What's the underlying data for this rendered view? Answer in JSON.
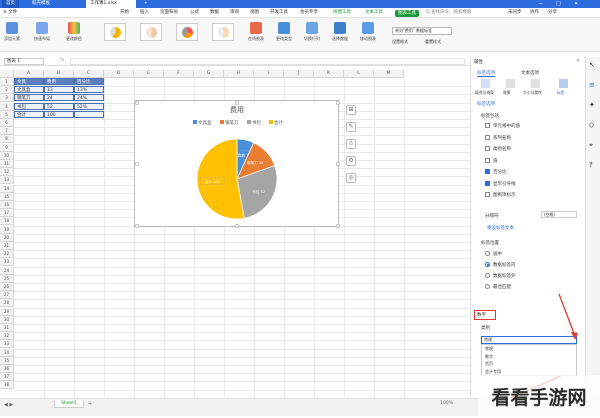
{
  "titlebar": {
    "tabs": [
      {
        "label": "首页"
      },
      {
        "label": "稻壳模板"
      },
      {
        "label": "工作簿1.xlsx"
      },
      {
        "label": "+"
      }
    ],
    "right": {
      "cloud": "未登录",
      "share": "分享"
    }
  },
  "menubar": {
    "file": "≡ 文件",
    "items": [
      "开始",
      "插入",
      "页面布局",
      "公式",
      "数据",
      "审阅",
      "视图",
      "开发工具",
      "会员专享"
    ],
    "chart_tools": "绘图工具",
    "text_tools": "文本工具",
    "chart_tools_active": "图表工具",
    "search": "Q 查找命令、搜索模板",
    "right": [
      "未同步",
      "协作",
      "分享"
    ]
  },
  "ribbon": {
    "buttons": [
      "添加元素",
      "快速布局",
      "更改颜色"
    ],
    "buttons2": [
      "在线图表",
      "更改类型",
      "切换行列",
      "选择数据",
      "移动图表"
    ],
    "series_select": "系列\"费用\" 数据标签",
    "format_label": "设置格式",
    "reset_label": "重置样式"
  },
  "formulabar": {
    "name_box": "图表 1",
    "fx": "fx"
  },
  "sheet": {
    "columns": [
      "A",
      "B",
      "C",
      "D",
      "E",
      "F",
      "G",
      "H",
      "I",
      "J",
      "K",
      "L",
      "M"
    ],
    "rows": [
      "1",
      "2",
      "3",
      "4",
      "5",
      "6",
      "7",
      "8",
      "9",
      "10",
      "11",
      "12",
      "13",
      "14",
      "15",
      "16",
      "17",
      "18",
      "19",
      "20",
      "21",
      "22",
      "23",
      "24",
      "25",
      "26",
      "27",
      "28",
      "29",
      "30",
      "31",
      "32",
      "33",
      "34",
      "35",
      "36",
      "37",
      "38"
    ],
    "table": [
      [
        "文具",
        "费用",
        "百分比"
      ],
      [
        "文具盒",
        "13",
        "13%"
      ],
      [
        "钢笔刀",
        "24",
        "24%"
      ],
      [
        "书包",
        "52",
        "52%"
      ],
      [
        "合计",
        "100",
        ""
      ]
    ],
    "sheet_tab": "Sheet1"
  },
  "chart_data": {
    "type": "pie",
    "title": "费用",
    "categories": [
      "文具盒",
      "钢笔刀",
      "书包",
      "合计"
    ],
    "values": [
      13,
      24,
      52,
      100
    ],
    "slice_labels": [
      "文具盒 13",
      "钢笔刀 24",
      "书包 52",
      "合计 100"
    ],
    "legend_placement": "top",
    "colors": [
      "#4a90d9",
      "#ed7d31",
      "#a5a5a5",
      "#ffc000"
    ]
  },
  "pane": {
    "title": "属性",
    "tabs": [
      "标签选项",
      "文本选项"
    ],
    "subtabs": [
      "填充与线条",
      "效果",
      "大小与属性",
      "标签"
    ],
    "section": "标签选项",
    "label_includes": "标签包括",
    "checkboxes": [
      {
        "label": "单元格中的值",
        "checked": false
      },
      {
        "label": "系列名称",
        "checked": false
      },
      {
        "label": "类别名称",
        "checked": false
      },
      {
        "label": "值",
        "checked": false
      },
      {
        "label": "百分比",
        "checked": true
      },
      {
        "label": "显示引导线",
        "checked": true
      },
      {
        "label": "图例项标示",
        "checked": false
      }
    ],
    "separator_label": "分隔符",
    "separator_value": "(空格)",
    "reset_text": "重设标签文本",
    "position_label": "标签位置",
    "positions": [
      {
        "label": "居中",
        "on": false
      },
      {
        "label": "数据标签内",
        "on": true
      },
      {
        "label": "数据标签外",
        "on": false
      },
      {
        "label": "最佳匹配",
        "on": false
      }
    ],
    "number_section": "数字",
    "category_label": "类别",
    "category_value": "常规",
    "dropdown_options": [
      "常规",
      "数字",
      "货币",
      "会计专用"
    ]
  },
  "statusbar": {
    "zoom": "100%"
  },
  "watermark": {
    "text": "看看手游网"
  }
}
